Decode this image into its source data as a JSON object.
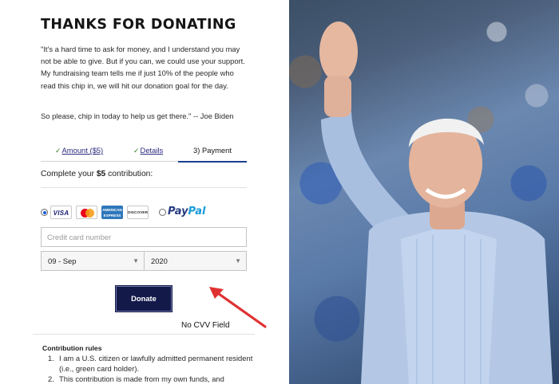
{
  "heading": "THANKS FOR DONATING",
  "quote": "\"It's a hard time to ask for money, and I understand you may not be able to give. But if you can, we could use your support. My fundraising team tells me if just 10% of the people who read this chip in, we will hit our donation goal for the day.",
  "signoff": "So please, chip in today to help us get there.\" -- Joe Biden",
  "tabs": {
    "amount": "Amount ($5)",
    "details": "Details",
    "payment": "3) Payment",
    "check": "✓"
  },
  "contribution": {
    "prefix": "Complete your ",
    "amount": "$5",
    "suffix": " contribution:"
  },
  "payment_methods": {
    "card_selected": true,
    "visa": "VISA",
    "amex_line1": "AMERICAN",
    "amex_line2": "EXPRESS",
    "discover": "DISCOVER",
    "paypal_part1": "Pay",
    "paypal_part2": "Pal"
  },
  "form": {
    "card_placeholder": "Credit card number",
    "card_value": "",
    "month": "09 - Sep",
    "year": "2020",
    "caret": "▼"
  },
  "donate_label": "Donate",
  "annotation": "No CVV Field",
  "rules": {
    "title": "Contribution rules",
    "items": [
      {
        "n": "1.",
        "text": "I am a U.S. citizen or lawfully admitted permanent resident (i.e., green card holder)."
      },
      {
        "n": "2.",
        "text": "This contribution is made from my own funds, and"
      }
    ]
  },
  "colors": {
    "donate_bg": "#131a4a",
    "tab_active": "#1c3e8f",
    "link": "#2a2a80",
    "arrow": "#e03131"
  }
}
